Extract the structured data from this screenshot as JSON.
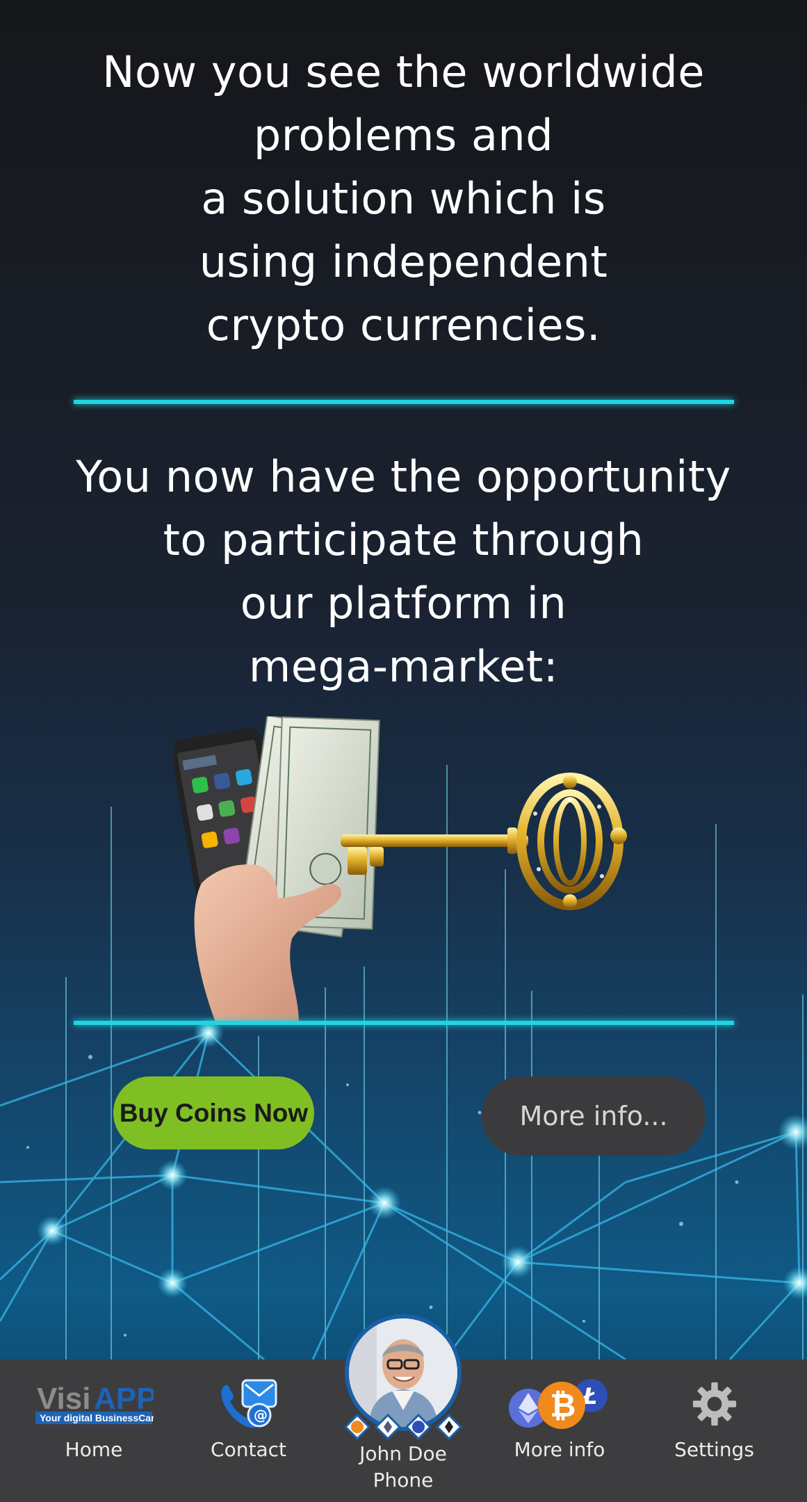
{
  "headline_1": {
    "lines": [
      "Now you see the worldwide",
      "problems and",
      "a solution which is",
      "using independent",
      "crypto currencies."
    ]
  },
  "headline_2": {
    "lines": [
      "You now have the opportunity",
      "to participate through",
      "our platform in",
      "mega-market:"
    ]
  },
  "buttons": {
    "buy_coins": "Buy Coins Now",
    "more_info": "More info..."
  },
  "bottom_nav": {
    "home": {
      "label": "Home",
      "icon": "visiapp-logo"
    },
    "contact": {
      "label": "Contact",
      "icon": "contact-icon"
    },
    "profile": {
      "name": "John Doe",
      "sub": "Phone",
      "icon": "profile-avatar"
    },
    "more_info": {
      "label": "More info",
      "icon": "crypto-coins-icon"
    },
    "settings": {
      "label": "Settings",
      "icon": "gear-icon"
    }
  },
  "logo": {
    "word_1": "Visi",
    "word_2": "APP",
    "tagline": "Your digital BusinessCard"
  },
  "colors": {
    "accent_line": "#1ed6e3",
    "buy_button": "#7fbf24",
    "more_button": "#3b3b3d",
    "nav_bar": "#3d3d3f",
    "avatar_ring": "#1a5fa6",
    "logo_blue": "#1e63b5",
    "logo_gray": "#888888"
  }
}
